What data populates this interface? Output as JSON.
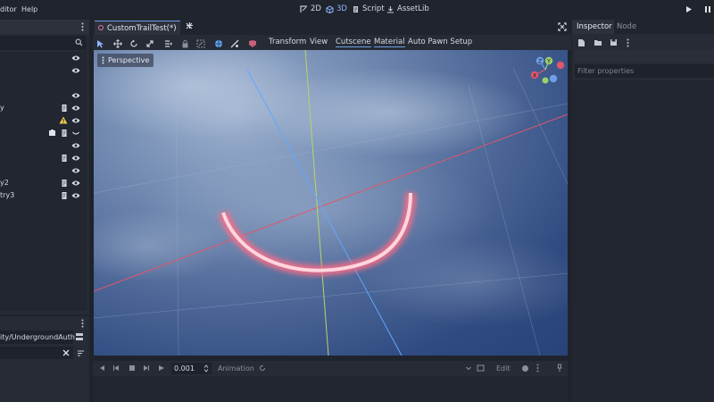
{
  "menu": {
    "editor": "ditor",
    "help": "Help"
  },
  "workspaces": [
    {
      "label": "2D",
      "icon": "2d-icon"
    },
    {
      "label": "3D",
      "icon": "3d-icon",
      "active": true
    },
    {
      "label": "Script",
      "icon": "script-icon"
    },
    {
      "label": "AssetLib",
      "icon": "assetlib-icon"
    }
  ],
  "scene_tab": {
    "title": "CustomTrailTest(*)"
  },
  "scene_tree": {
    "rows": [
      {
        "label": "",
        "script": false,
        "warning": false,
        "eye": true
      },
      {
        "label": "",
        "script": false,
        "warning": false,
        "eye": true
      },
      {
        "label": "",
        "script": false,
        "warning": false,
        "eye": false
      },
      {
        "label": "",
        "script": false,
        "warning": false,
        "eye": true
      },
      {
        "label": "y",
        "script": true,
        "warning": false,
        "eye": true
      },
      {
        "label": "",
        "script": false,
        "warning": true,
        "eye": true
      },
      {
        "label": "",
        "script": true,
        "warning": false,
        "eye": false,
        "extra": true
      },
      {
        "label": "",
        "script": false,
        "warning": false,
        "eye": true
      },
      {
        "label": "",
        "script": true,
        "warning": false,
        "eye": true
      },
      {
        "label": "",
        "script": false,
        "warning": false,
        "eye": true
      },
      {
        "label": "y2",
        "script": true,
        "warning": false,
        "eye": true
      },
      {
        "label": "try3",
        "script": true,
        "warning": false,
        "eye": true
      }
    ]
  },
  "filesystem": {
    "path": "ity/UndergroundAuth"
  },
  "toolbar_menus": {
    "transform": "Transform",
    "view": "View",
    "cutscene": "Cutscene",
    "material": "Material",
    "auto_pawn": "Auto Pawn Setup"
  },
  "viewport": {
    "perspective_label": "Perspective",
    "gizmo": {
      "y": "Y",
      "z": "Z",
      "x": "X"
    }
  },
  "inspector": {
    "tab_inspector": "Inspector",
    "tab_node": "Node",
    "filter_placeholder": "Filter properties"
  },
  "animation": {
    "time": "0.001",
    "animation_label": "Animation",
    "edit_label": "Edit"
  },
  "colors": {
    "accent": "#6f9fe8",
    "axis_x": "#e0566c",
    "axis_y": "#b8d46a",
    "axis_z": "#5fa8ff",
    "trail": "#ff7a8f"
  }
}
